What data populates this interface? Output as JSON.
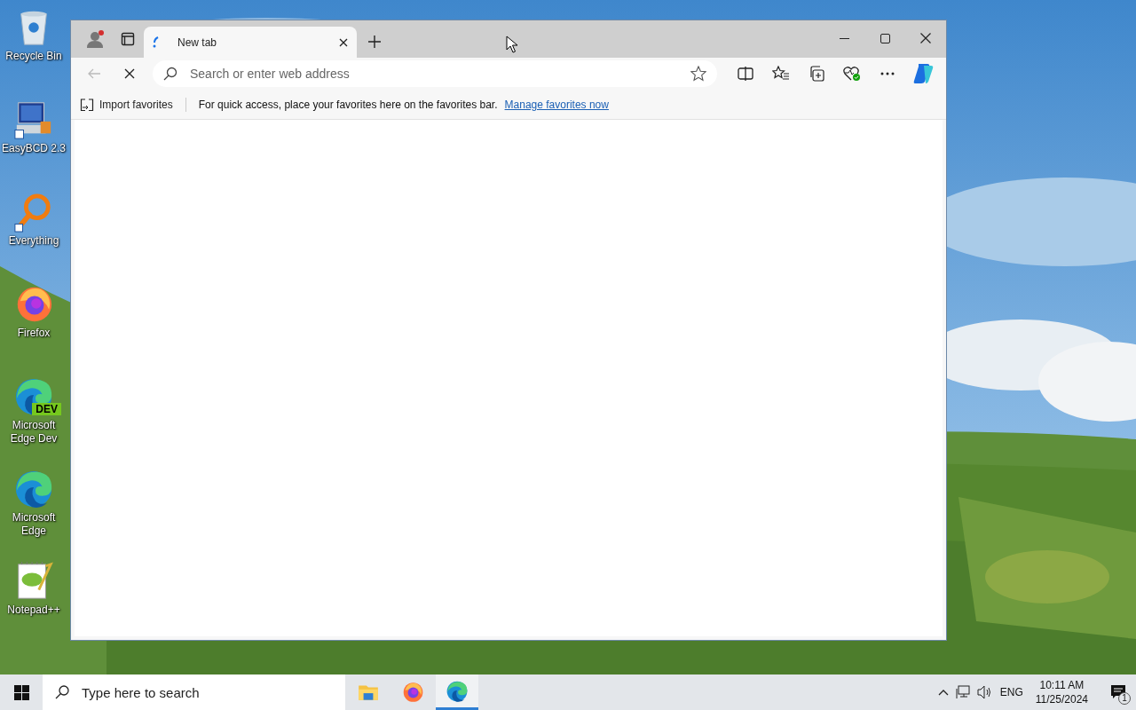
{
  "desktop_icons": [
    {
      "label": "Recycle Bin",
      "kind": "recycle"
    },
    {
      "label": "EasyBCD 2.3",
      "kind": "easybcd"
    },
    {
      "label": "Everything",
      "kind": "everything"
    },
    {
      "label": "Firefox",
      "kind": "firefox"
    },
    {
      "label": "Microsoft Edge Dev",
      "kind": "edgedev",
      "badge": "DEV"
    },
    {
      "label": "Microsoft Edge",
      "kind": "edge"
    },
    {
      "label": "Notepad++",
      "kind": "notepad"
    }
  ],
  "browser": {
    "tabs": [
      {
        "title": "New tab",
        "selected": true
      }
    ],
    "address": {
      "placeholder": "Search or enter web address"
    },
    "favorites_bar": {
      "import_label": "Import favorites",
      "message": "For quick access, place your favorites here on the favorites bar.",
      "link": "Manage favorites now"
    }
  },
  "taskbar": {
    "search": {
      "placeholder": "Type here to search"
    },
    "apps": [
      {
        "kind": "explorer",
        "selected": false
      },
      {
        "kind": "firefox",
        "selected": false
      },
      {
        "kind": "edge",
        "selected": true
      }
    ],
    "language": "ENG",
    "time": "10:11 AM",
    "date": "11/25/2024",
    "notifications": "1"
  }
}
